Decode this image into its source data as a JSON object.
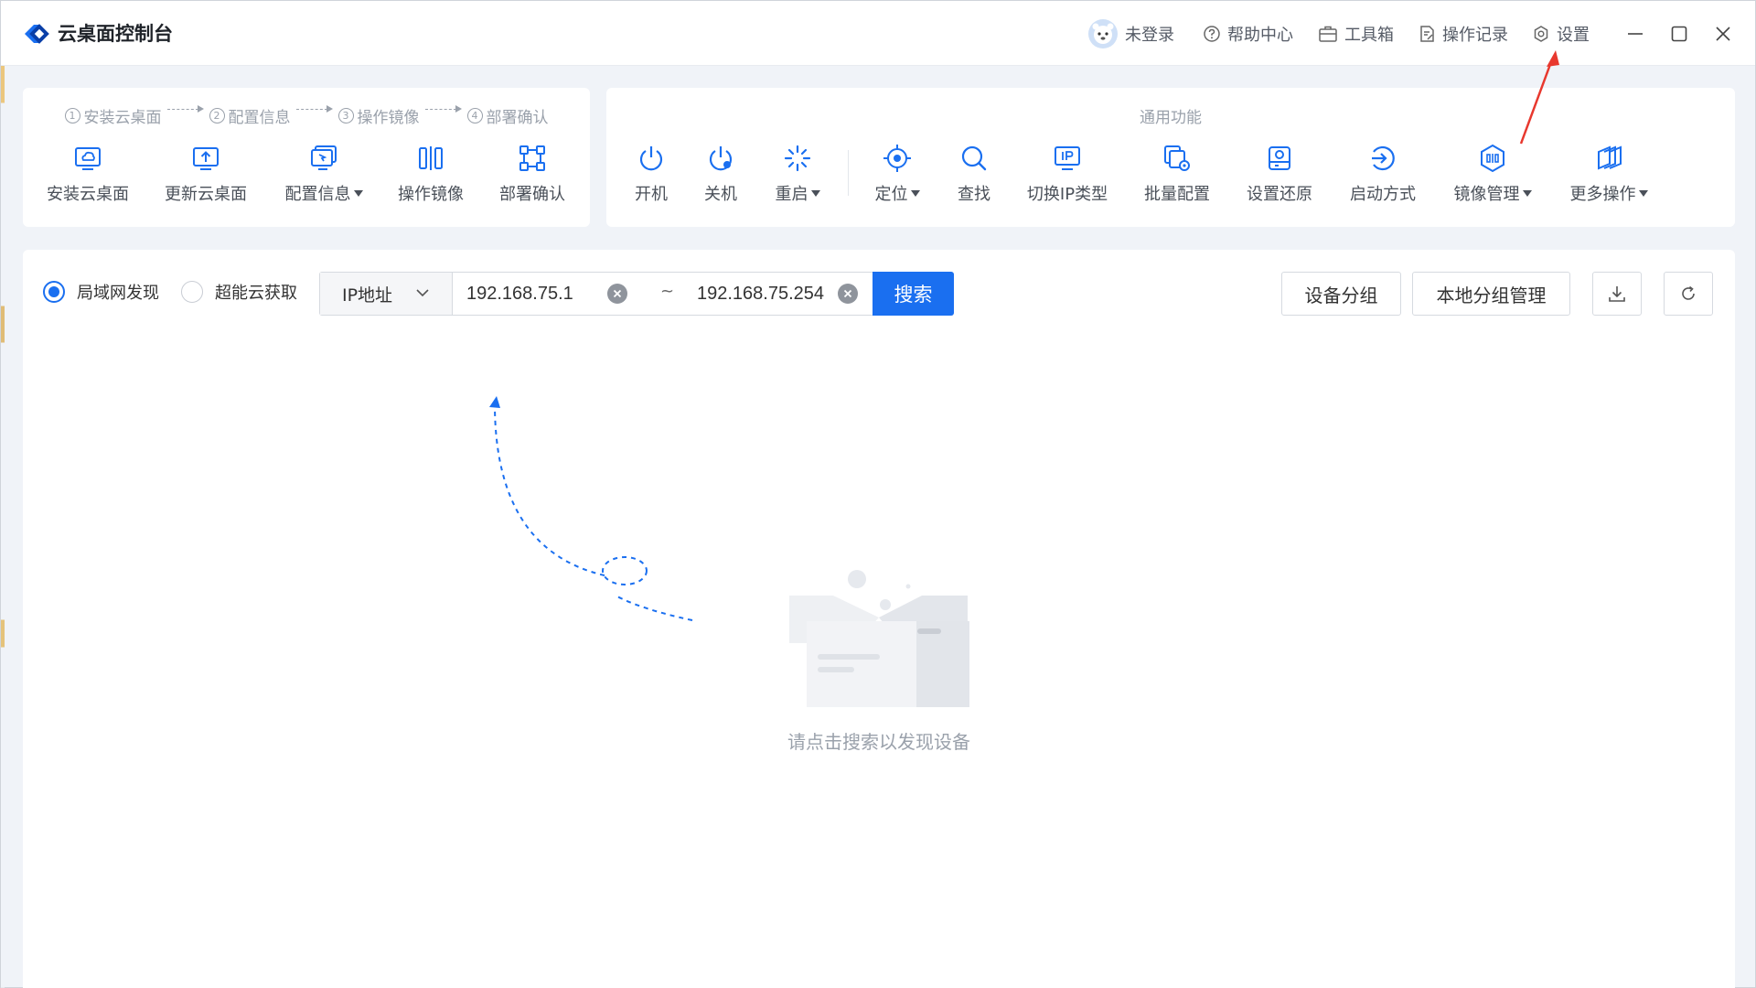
{
  "app": {
    "title": "云桌面控制台"
  },
  "titlebar": {
    "user": "未登录",
    "help": "帮助中心",
    "toolbox": "工具箱",
    "log": "操作记录",
    "settings": "设置"
  },
  "wizard": {
    "steps": [
      {
        "num": "1",
        "label": "安装云桌面"
      },
      {
        "num": "2",
        "label": "配置信息"
      },
      {
        "num": "3",
        "label": "操作镜像"
      },
      {
        "num": "4",
        "label": "部署确认"
      }
    ],
    "tools": [
      {
        "label": "安装云桌面",
        "icon": "install-desktop-icon"
      },
      {
        "label": "更新云桌面",
        "icon": "update-desktop-icon"
      },
      {
        "label": "配置信息",
        "icon": "config-info-icon",
        "dropdown": true
      },
      {
        "label": "操作镜像",
        "icon": "mirror-icon"
      },
      {
        "label": "部署确认",
        "icon": "deploy-icon"
      }
    ]
  },
  "common": {
    "title": "通用功能",
    "tools": [
      {
        "label": "开机",
        "icon": "power-on-icon"
      },
      {
        "label": "关机",
        "icon": "power-off-icon"
      },
      {
        "label": "重启",
        "icon": "restart-icon",
        "dropdown": true
      },
      {
        "label": "定位",
        "icon": "locate-icon",
        "dropdown": true
      },
      {
        "label": "查找",
        "icon": "search-icon"
      },
      {
        "label": "切换IP类型",
        "icon": "ip-icon"
      },
      {
        "label": "批量配置",
        "icon": "batch-config-icon"
      },
      {
        "label": "设置还原",
        "icon": "restore-icon"
      },
      {
        "label": "启动方式",
        "icon": "boot-mode-icon"
      },
      {
        "label": "镜像管理",
        "icon": "image-manage-icon",
        "dropdown": true
      },
      {
        "label": "更多操作",
        "icon": "more-icon",
        "dropdown": true
      }
    ]
  },
  "search": {
    "mode_lan": "局域网发现",
    "mode_cloud": "超能云获取",
    "type_selected": "IP地址",
    "ip_start": "192.168.75.1",
    "ip_end": "192.168.75.254",
    "separator": "~",
    "button": "搜索"
  },
  "actions": {
    "group": "设备分组",
    "local_group": "本地分组管理"
  },
  "empty": {
    "message": "请点击搜索以发现设备"
  },
  "colors": {
    "accent": "#1a6ff0",
    "annotation": "#e8382e"
  }
}
